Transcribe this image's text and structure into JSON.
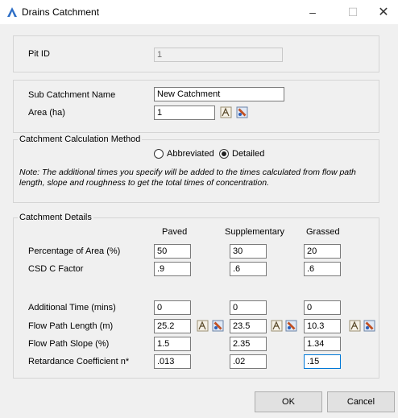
{
  "window": {
    "title": "Drains Catchment",
    "minimize_glyph": "–",
    "maximize_glyph": "☐",
    "close_glyph": "✕"
  },
  "pit": {
    "label": "Pit ID",
    "value": "1"
  },
  "subcatchment": {
    "name_label": "Sub Catchment Name",
    "name_value": "New Catchment",
    "area_label": "Area (ha)",
    "area_value": "1"
  },
  "method": {
    "group_label": "Catchment Calculation Method",
    "options": [
      "Abbreviated",
      "Detailed"
    ],
    "selected": "Detailed",
    "note": "Note: The additional times you specify will be added to the times calculated from flow path length, slope and roughness to get the total times of concentration."
  },
  "details": {
    "group_label": "Catchment Details",
    "columns": [
      "Paved",
      "Supplementary",
      "Grassed"
    ],
    "rows": [
      {
        "label": "Percentage of Area (%)",
        "values": [
          "50",
          "30",
          "20"
        ]
      },
      {
        "label": "CSD C Factor",
        "values": [
          ".9",
          ".6",
          ".6"
        ]
      },
      {
        "label": "Additional Time (mins)",
        "values": [
          "0",
          "0",
          "0"
        ]
      },
      {
        "label": "Flow Path Length (m)",
        "values": [
          "25.2",
          "23.5",
          "10.3"
        ]
      },
      {
        "label": "Flow Path Slope (%)",
        "values": [
          "1.5",
          "2.35",
          "1.34"
        ]
      },
      {
        "label": "Retardance Coefficient n*",
        "values": [
          ".013",
          ".02",
          ".15"
        ]
      }
    ]
  },
  "footer": {
    "ok_label": "OK",
    "cancel_label": "Cancel"
  },
  "icons": {
    "app": "app-logo-icon",
    "measure": "measure-tool-icon",
    "pick": "pick-from-drawing-icon"
  },
  "colors": {
    "accent": "#0078d7",
    "app_icon": "#2f6fc6",
    "dialog_bg": "#f0f0f0"
  }
}
